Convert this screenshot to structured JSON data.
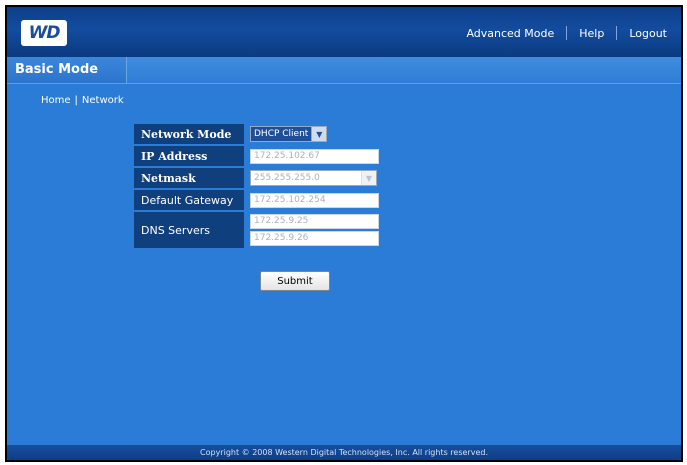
{
  "header": {
    "logo_text": "WD",
    "nav": [
      {
        "label": "Advanced Mode"
      },
      {
        "label": "Help"
      },
      {
        "label": "Logout"
      }
    ]
  },
  "tab": {
    "label": "Basic Mode"
  },
  "breadcrumb": {
    "home": "Home",
    "separator": "|",
    "current": "Network"
  },
  "form": {
    "network_mode": {
      "label": "Network Mode",
      "value": "DHCP Client"
    },
    "ip_address": {
      "label": "IP Address",
      "value": "172.25.102.67"
    },
    "netmask": {
      "label": "Netmask",
      "value": "255.255.255.0"
    },
    "gateway": {
      "label": "Default Gateway",
      "value": "172.25.102.254"
    },
    "dns": {
      "label": "DNS Servers",
      "primary": "172.25.9.25",
      "secondary": "172.25.9.26"
    },
    "submit_label": "Submit"
  },
  "footer": {
    "copyright": "Copyright © 2008 Western Digital Technologies, Inc. All rights reserved."
  },
  "icons": {
    "dropdown": "chevron-down-icon"
  }
}
